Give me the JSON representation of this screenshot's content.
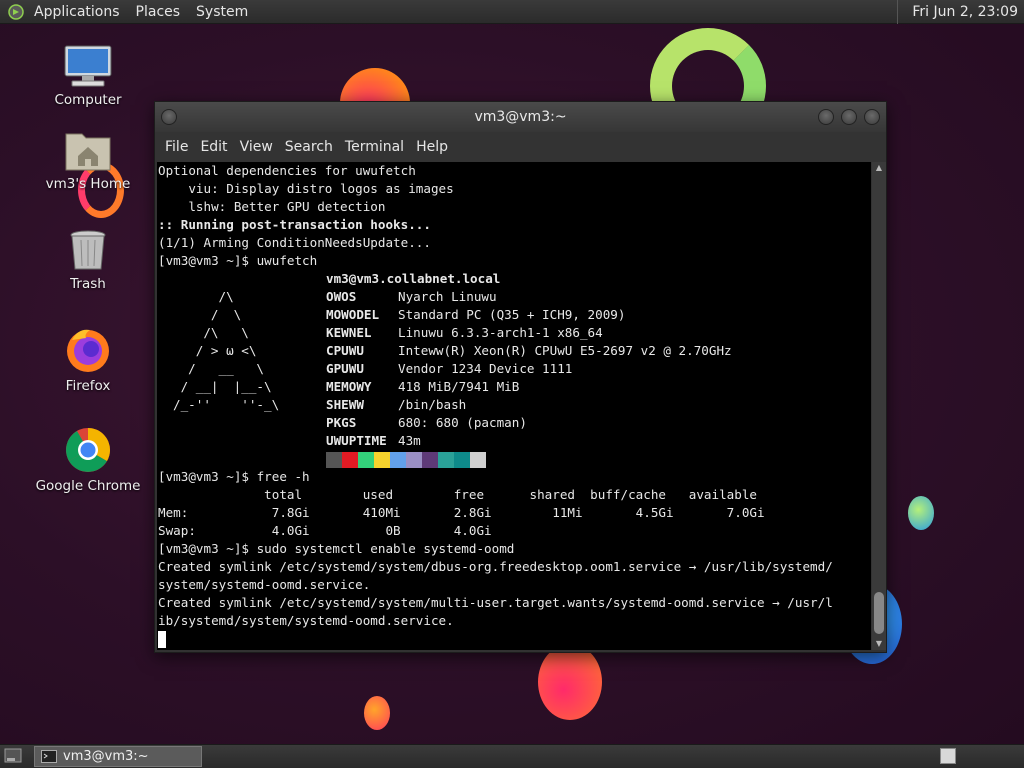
{
  "top_panel": {
    "menus": [
      "Applications",
      "Places",
      "System"
    ],
    "clock": "Fri Jun  2, 23:09"
  },
  "desktop_icons": [
    {
      "label": "Computer",
      "icon": "computer-icon"
    },
    {
      "label": "vm3's Home",
      "icon": "home-folder-icon"
    },
    {
      "label": "Trash",
      "icon": "trash-icon"
    },
    {
      "label": "Firefox",
      "icon": "firefox-icon"
    },
    {
      "label": "Google Chrome",
      "icon": "chrome-icon"
    }
  ],
  "window": {
    "title": "vm3@vm3:~",
    "menus": [
      "File",
      "Edit",
      "View",
      "Search",
      "Terminal",
      "Help"
    ]
  },
  "terminal": {
    "pre_lines": [
      "Optional dependencies for uwufetch",
      "    viu: Display distro logos as images",
      "    lshw: Better GPU detection"
    ],
    "hook_line": ":: Running post-transaction hooks...",
    "arming_line": "(1/1) Arming ConditionNeedsUpdate...",
    "prompt1": "[vm3@vm3 ~]$ uwufetch",
    "logo": [
      "      /\\",
      "     /  \\",
      "    /\\   \\",
      "   / > ω <\\",
      "  /   __   \\",
      " / __|  |__-\\",
      "/_-''    ''-_\\"
    ],
    "fetch_host": "vm3@vm3.collabnet.local",
    "fetch": [
      {
        "key": "OWOS",
        "value": "Nyarch Linuwu"
      },
      {
        "key": "MOWODEL",
        "value": "Standard PC (Q35 + ICH9, 2009)"
      },
      {
        "key": "KEWNEL",
        "value": "Linuwu 6.3.3-arch1-1 x86_64"
      },
      {
        "key": "CPUWU",
        "value": "Inteww(R) Xeon(R) CPUwU E5-2697 v2 @ 2.70GHz"
      },
      {
        "key": "GPUWU",
        "value": "Vendor 1234 Device 1111"
      },
      {
        "key": "MEMOWY",
        "value": "418 MiB/7941 MiB"
      },
      {
        "key": "SHEWW",
        "value": "/bin/bash"
      },
      {
        "key": "PKGS",
        "value": "680: 680 (pacman)"
      },
      {
        "key": "UWUPTIME",
        "value": "43m"
      }
    ],
    "swatches": [
      "#555555",
      "#e01b24",
      "#33d17a",
      "#f6d32d",
      "#62a0ea",
      "#9a8fc4",
      "#5e3a78",
      "#2aa198",
      "#0e8a8a",
      "#d0d0d0"
    ],
    "prompt2": "[vm3@vm3 ~]$ free -h",
    "free_header": "              total        used        free      shared  buff/cache   available",
    "free_mem": "Mem:           7.8Gi       410Mi       2.8Gi        11Mi       4.5Gi       7.0Gi",
    "free_swap": "Swap:          4.0Gi          0B       4.0Gi",
    "prompt3": "[vm3@vm3 ~]$ sudo systemctl enable systemd-oomd",
    "post_lines": [
      "Created symlink /etc/systemd/system/dbus-org.freedesktop.oom1.service → /usr/lib/systemd/",
      "system/systemd-oomd.service.",
      "Created symlink /etc/systemd/system/multi-user.target.wants/systemd-oomd.service → /usr/l",
      "ib/systemd/system/systemd-oomd.service."
    ]
  },
  "bottom_panel": {
    "task_label": "vm3@vm3:~"
  }
}
